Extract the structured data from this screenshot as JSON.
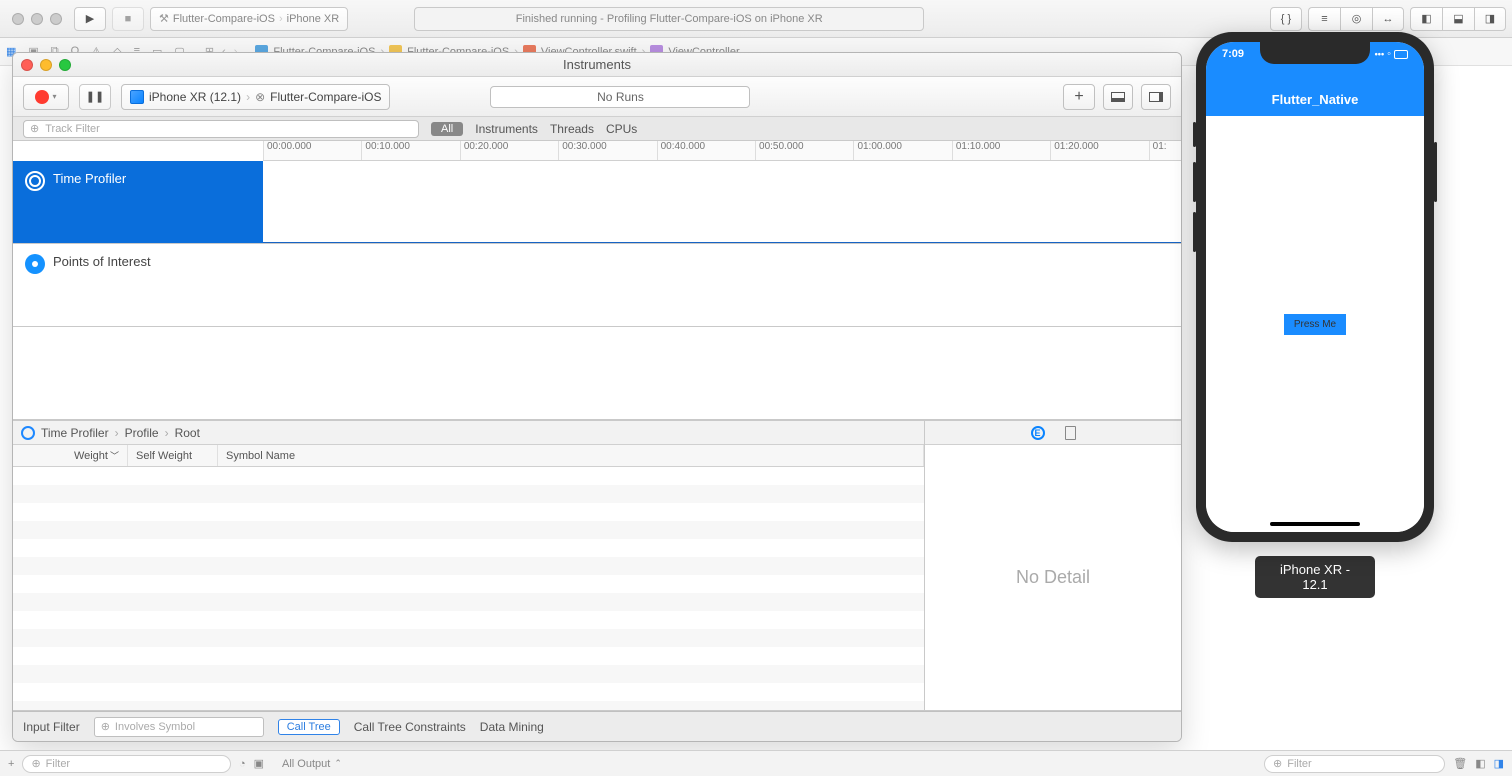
{
  "xcode": {
    "scheme": "Flutter-Compare-iOS",
    "device": "iPhone XR",
    "status": "Finished running - Profiling Flutter-Compare-iOS on iPhone XR",
    "jumpbar": {
      "project": "Flutter-Compare-iOS",
      "folder": "Flutter-Compare-iOS",
      "file": "ViewController.swift",
      "class": "ViewController"
    },
    "bottom": {
      "filter_placeholder": "Filter",
      "output": "All Output",
      "right_filter_placeholder": "Filter"
    }
  },
  "instruments": {
    "title": "Instruments",
    "device": "iPhone XR (12.1)",
    "target": "Flutter-Compare-iOS",
    "runs": "No Runs",
    "track_filter_placeholder": "Track Filter",
    "tabs": {
      "all": "All",
      "instruments": "Instruments",
      "threads": "Threads",
      "cpus": "CPUs"
    },
    "ruler": [
      "00:00.000",
      "00:10.000",
      "00:20.000",
      "00:30.000",
      "00:40.000",
      "00:50.000",
      "01:00.000",
      "01:10.000",
      "01:20.000",
      "01:"
    ],
    "tracks": {
      "time_profiler": "Time Profiler",
      "poi": "Points of Interest"
    },
    "detail_path": {
      "a": "Time Profiler",
      "b": "Profile",
      "c": "Root"
    },
    "columns": {
      "weight": "Weight",
      "self_weight": "Self Weight",
      "symbol": "Symbol Name"
    },
    "no_detail": "No Detail",
    "bottom": {
      "input_filter": "Input Filter",
      "involves_placeholder": "Involves Symbol",
      "call_tree": "Call Tree",
      "constraints": "Call Tree Constraints",
      "data_mining": "Data Mining"
    }
  },
  "simulator": {
    "time": "7:09",
    "app_title": "Flutter_Native",
    "button": "Press Me",
    "label": "iPhone XR - 12.1"
  }
}
